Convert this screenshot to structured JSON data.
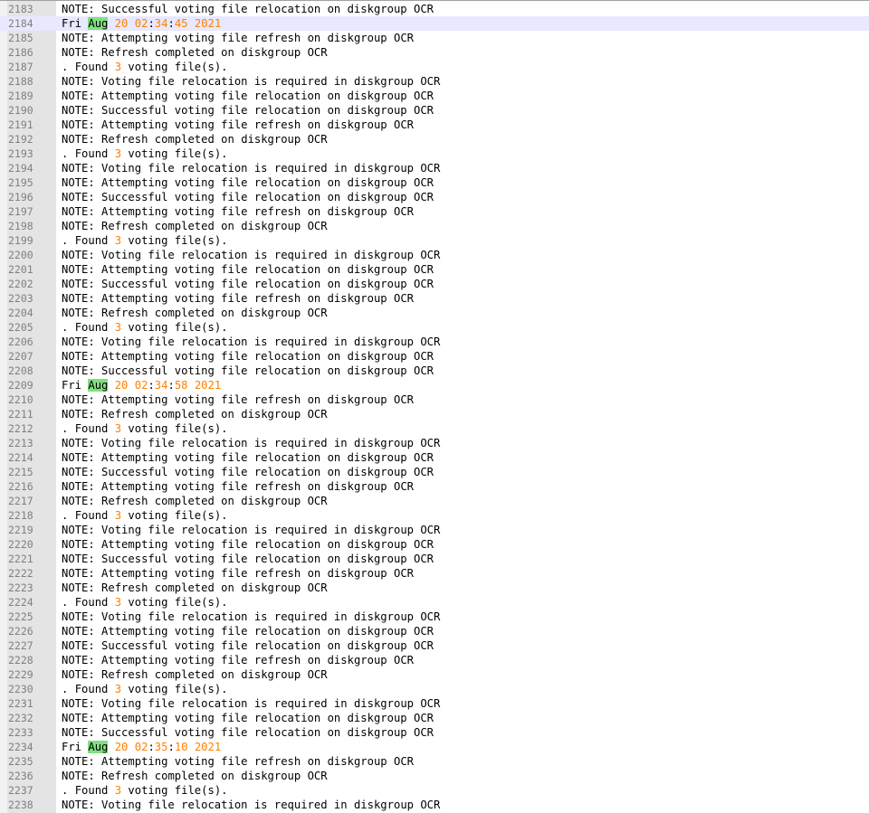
{
  "editor": {
    "current_line": 2184,
    "colors": {
      "number": "#ff8000",
      "month_highlight": "#80e080",
      "current_line": "#e8e8ff",
      "gutter": "#e4e4e4",
      "line_number": "#808080"
    },
    "lines": [
      {
        "n": "2183",
        "t": "NOTE: Successful voting file relocation on diskgroup OCR"
      },
      {
        "n": "2184",
        "t": "Fri Aug 20 02:34:45 2021"
      },
      {
        "n": "2185",
        "t": "NOTE: Attempting voting file refresh on diskgroup OCR"
      },
      {
        "n": "2186",
        "t": "NOTE: Refresh completed on diskgroup OCR"
      },
      {
        "n": "2187",
        "t": ". Found 3 voting file(s)."
      },
      {
        "n": "2188",
        "t": "NOTE: Voting file relocation is required in diskgroup OCR"
      },
      {
        "n": "2189",
        "t": "NOTE: Attempting voting file relocation on diskgroup OCR"
      },
      {
        "n": "2190",
        "t": "NOTE: Successful voting file relocation on diskgroup OCR"
      },
      {
        "n": "2191",
        "t": "NOTE: Attempting voting file refresh on diskgroup OCR"
      },
      {
        "n": "2192",
        "t": "NOTE: Refresh completed on diskgroup OCR"
      },
      {
        "n": "2193",
        "t": ". Found 3 voting file(s)."
      },
      {
        "n": "2194",
        "t": "NOTE: Voting file relocation is required in diskgroup OCR"
      },
      {
        "n": "2195",
        "t": "NOTE: Attempting voting file relocation on diskgroup OCR"
      },
      {
        "n": "2196",
        "t": "NOTE: Successful voting file relocation on diskgroup OCR"
      },
      {
        "n": "2197",
        "t": "NOTE: Attempting voting file refresh on diskgroup OCR"
      },
      {
        "n": "2198",
        "t": "NOTE: Refresh completed on diskgroup OCR"
      },
      {
        "n": "2199",
        "t": ". Found 3 voting file(s)."
      },
      {
        "n": "2200",
        "t": "NOTE: Voting file relocation is required in diskgroup OCR"
      },
      {
        "n": "2201",
        "t": "NOTE: Attempting voting file relocation on diskgroup OCR"
      },
      {
        "n": "2202",
        "t": "NOTE: Successful voting file relocation on diskgroup OCR"
      },
      {
        "n": "2203",
        "t": "NOTE: Attempting voting file refresh on diskgroup OCR"
      },
      {
        "n": "2204",
        "t": "NOTE: Refresh completed on diskgroup OCR"
      },
      {
        "n": "2205",
        "t": ". Found 3 voting file(s)."
      },
      {
        "n": "2206",
        "t": "NOTE: Voting file relocation is required in diskgroup OCR"
      },
      {
        "n": "2207",
        "t": "NOTE: Attempting voting file relocation on diskgroup OCR"
      },
      {
        "n": "2208",
        "t": "NOTE: Successful voting file relocation on diskgroup OCR"
      },
      {
        "n": "2209",
        "t": "Fri Aug 20 02:34:58 2021"
      },
      {
        "n": "2210",
        "t": "NOTE: Attempting voting file refresh on diskgroup OCR"
      },
      {
        "n": "2211",
        "t": "NOTE: Refresh completed on diskgroup OCR"
      },
      {
        "n": "2212",
        "t": ". Found 3 voting file(s)."
      },
      {
        "n": "2213",
        "t": "NOTE: Voting file relocation is required in diskgroup OCR"
      },
      {
        "n": "2214",
        "t": "NOTE: Attempting voting file relocation on diskgroup OCR"
      },
      {
        "n": "2215",
        "t": "NOTE: Successful voting file relocation on diskgroup OCR"
      },
      {
        "n": "2216",
        "t": "NOTE: Attempting voting file refresh on diskgroup OCR"
      },
      {
        "n": "2217",
        "t": "NOTE: Refresh completed on diskgroup OCR"
      },
      {
        "n": "2218",
        "t": ". Found 3 voting file(s)."
      },
      {
        "n": "2219",
        "t": "NOTE: Voting file relocation is required in diskgroup OCR"
      },
      {
        "n": "2220",
        "t": "NOTE: Attempting voting file relocation on diskgroup OCR"
      },
      {
        "n": "2221",
        "t": "NOTE: Successful voting file relocation on diskgroup OCR"
      },
      {
        "n": "2222",
        "t": "NOTE: Attempting voting file refresh on diskgroup OCR"
      },
      {
        "n": "2223",
        "t": "NOTE: Refresh completed on diskgroup OCR"
      },
      {
        "n": "2224",
        "t": ". Found 3 voting file(s)."
      },
      {
        "n": "2225",
        "t": "NOTE: Voting file relocation is required in diskgroup OCR"
      },
      {
        "n": "2226",
        "t": "NOTE: Attempting voting file relocation on diskgroup OCR"
      },
      {
        "n": "2227",
        "t": "NOTE: Successful voting file relocation on diskgroup OCR"
      },
      {
        "n": "2228",
        "t": "NOTE: Attempting voting file refresh on diskgroup OCR"
      },
      {
        "n": "2229",
        "t": "NOTE: Refresh completed on diskgroup OCR"
      },
      {
        "n": "2230",
        "t": ". Found 3 voting file(s)."
      },
      {
        "n": "2231",
        "t": "NOTE: Voting file relocation is required in diskgroup OCR"
      },
      {
        "n": "2232",
        "t": "NOTE: Attempting voting file relocation on diskgroup OCR"
      },
      {
        "n": "2233",
        "t": "NOTE: Successful voting file relocation on diskgroup OCR"
      },
      {
        "n": "2234",
        "t": "Fri Aug 20 02:35:10 2021"
      },
      {
        "n": "2235",
        "t": "NOTE: Attempting voting file refresh on diskgroup OCR"
      },
      {
        "n": "2236",
        "t": "NOTE: Refresh completed on diskgroup OCR"
      },
      {
        "n": "2237",
        "t": ". Found 3 voting file(s)."
      },
      {
        "n": "2238",
        "t": "NOTE: Voting file relocation is required in diskgroup OCR"
      }
    ]
  }
}
